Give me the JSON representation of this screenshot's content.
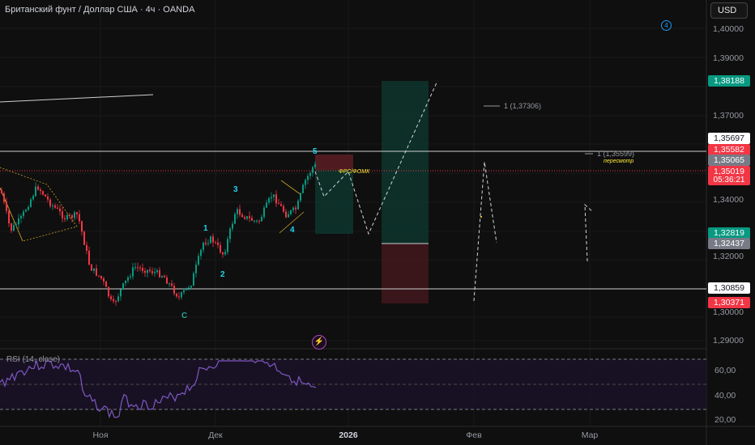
{
  "header": {
    "title": "Британский фунт / Доллар США · 4ч · OANDA"
  },
  "currency_button": {
    "label": "USD"
  },
  "alert_badge": {
    "label": "4"
  },
  "price_axis": [
    "1,40000",
    "1,39000",
    "1,37000",
    "1,34000",
    "1,32000",
    "1,30000",
    "1,29000"
  ],
  "price_tags": [
    {
      "value": "1,38188",
      "bg": "#089981",
      "fg": "#ffffff"
    },
    {
      "value": "1,35697",
      "bg": "#ffffff",
      "fg": "#131722"
    },
    {
      "value": "1,35582",
      "bg": "#f23645",
      "fg": "#ffffff"
    },
    {
      "value": "1,35065",
      "bg": "#787b86",
      "fg": "#ffffff"
    },
    {
      "value": "1,35019",
      "bg": "#f23645",
      "fg": "#ffffff"
    },
    {
      "value": "1,32819",
      "bg": "#089981",
      "fg": "#ffffff"
    },
    {
      "value": "1,32437",
      "bg": "#787b86",
      "fg": "#ffffff"
    },
    {
      "value": "1,30859",
      "bg": "#ffffff",
      "fg": "#131722"
    },
    {
      "value": "1,30371",
      "bg": "#f23645",
      "fg": "#ffffff"
    }
  ],
  "countdown": "05:36:21",
  "time_axis": [
    "Ноя",
    "Дек",
    "2026",
    "Фев",
    "Мар"
  ],
  "annotations": {
    "level_high": "1 (1,37306)",
    "level_mid": "1 (1,35599)",
    "review": "пересмотр",
    "fomc": "ФРС/ФОМК"
  },
  "waves": [
    "1",
    "2",
    "3",
    "4",
    "5",
    "C"
  ],
  "rsi": {
    "label": "RSI (14, close)",
    "axis": [
      "60,00",
      "40,00",
      "20,00"
    ]
  },
  "colors": {
    "up": "#089981",
    "down": "#f23645",
    "rsi": "#7e57c2",
    "bg": "#0f0f0f"
  }
}
